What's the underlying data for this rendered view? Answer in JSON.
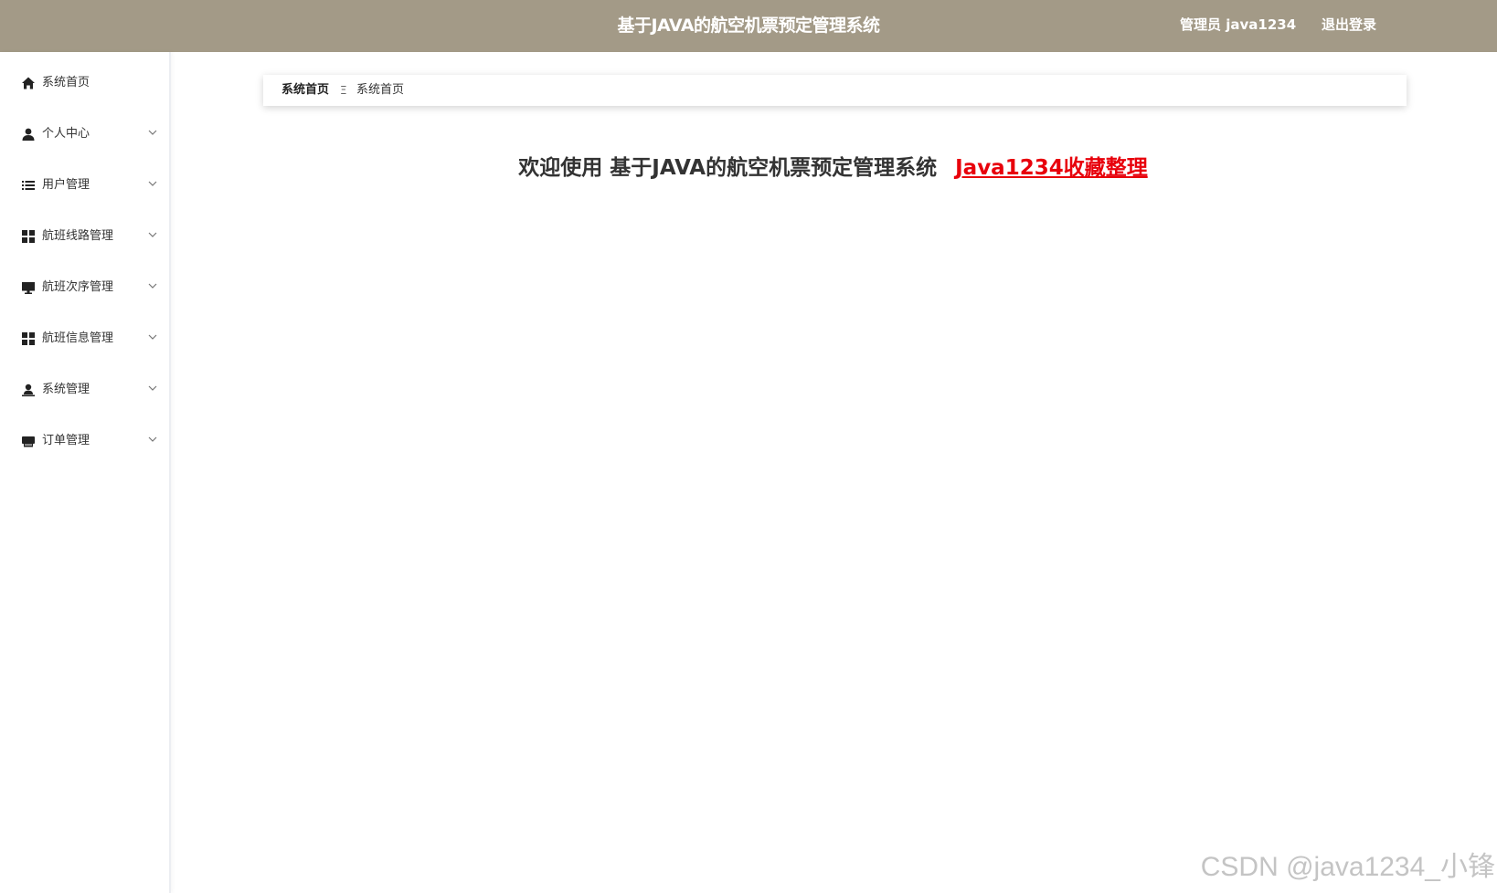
{
  "header": {
    "app_title": "基于JAVA的航空机票预定管理系统",
    "user_label": "管理员 java1234",
    "logout_label": "退出登录"
  },
  "sidebar": {
    "items": [
      {
        "label": "系统首页",
        "icon": "home-icon",
        "expandable": false
      },
      {
        "label": "个人中心",
        "icon": "user-icon",
        "expandable": true
      },
      {
        "label": "用户管理",
        "icon": "list-icon",
        "expandable": true
      },
      {
        "label": "航班线路管理",
        "icon": "grid-icon",
        "expandable": true
      },
      {
        "label": "航班次序管理",
        "icon": "monitor-icon",
        "expandable": true
      },
      {
        "label": "航班信息管理",
        "icon": "grid-icon",
        "expandable": true
      },
      {
        "label": "系统管理",
        "icon": "admin-user-icon",
        "expandable": true
      },
      {
        "label": "订单管理",
        "icon": "printer-icon",
        "expandable": true
      }
    ]
  },
  "breadcrumb": {
    "home": "系统首页",
    "separator": "Ξ",
    "current": "系统首页"
  },
  "main": {
    "welcome_text": "欢迎使用 基于JAVA的航空机票预定管理系统",
    "collect_link": "Java1234收藏整理"
  },
  "watermark": "CSDN @java1234_小锋",
  "colors": {
    "header_bg": "#a39a87",
    "link_red": "#e8000b",
    "text": "#333333"
  }
}
